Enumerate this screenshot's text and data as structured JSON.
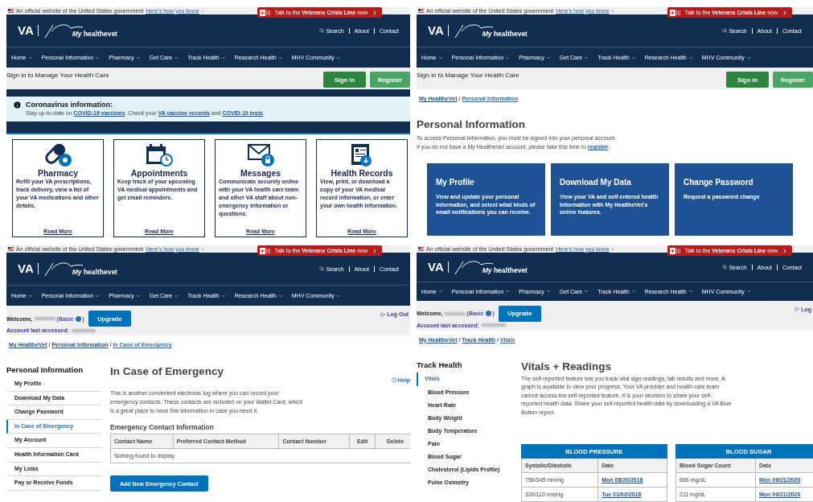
{
  "panels": [
    {
      "kind": "home",
      "header": {
        "banner_text": "An official website of the United States government",
        "banner_link": "Here's how you know",
        "crisis": "Talk to the **Veterans Crisis Line** now",
        "logo_mark": "VA",
        "logo_name": "*My* healthevet",
        "utility_links": [
          "Search",
          "About",
          "Contact"
        ],
        "nav": [
          "Home",
          "Personal Information",
          "Pharmacy",
          "Get Care",
          "Track Health",
          "Research Health",
          "MHV Community"
        ]
      },
      "signin": {
        "prompt": "Sign in to Manage Your Health Care",
        "buttons": [
          "Sign in",
          "Register"
        ]
      },
      "alert": {
        "title": "Coronavirus information:",
        "parts": [
          {
            "text": "Stay up-to-date on ",
            "link": false
          },
          {
            "text": "COVID-19 vaccines",
            "link": true
          },
          {
            "text": ". Check your ",
            "link": false
          },
          {
            "text": "VA vaccine records",
            "link": true
          },
          {
            "text": " and ",
            "link": false
          },
          {
            "text": "COVID-19 tests",
            "link": true
          },
          {
            "text": ".",
            "link": false
          }
        ]
      },
      "cards": [
        {
          "title": "Pharmacy",
          "text": "Refill your VA prescriptions, track delivery, view a list of your VA medications and other details.",
          "link": "Read More"
        },
        {
          "title": "Appointments",
          "text": "Keep track of your upcoming VA medical appointments and get email reminders.",
          "link": "Read More"
        },
        {
          "title": "Messages",
          "text": "Communicate securely online with your VA health care team and other VA staff about non-emergency information or questions.",
          "link": "Read More"
        },
        {
          "title": "Health Records",
          "text": "View, print, or download a copy of your VA medical record information, or enter your own health information.",
          "link": "Read More"
        }
      ]
    },
    {
      "kind": "landing",
      "header": {
        "banner_text": "An official website of the United States government",
        "banner_link": "Here's how you know",
        "crisis": "Talk to the **Veterans Crisis Line** now",
        "logo_mark": "VA",
        "logo_name": "*My* healthevet",
        "utility_links": [
          "Search",
          "About",
          "Contact"
        ],
        "nav": [
          "Home",
          "Personal Information",
          "Pharmacy",
          "Get Care",
          "Track Health",
          "Research Health",
          "MHV Community"
        ]
      },
      "signin": {
        "prompt": "Sign in to Manage Your Health Care",
        "buttons": [
          "Sign in",
          "Register"
        ]
      },
      "breadcrumb": [
        "My HealtheVet",
        "Personal Information"
      ],
      "breadcrumb_separator": "/",
      "title": "Personal Information",
      "parts": [
        {
          "text": "To access Personal Information, you must be signed into your personal account. If you do not have a My HealtheVet account, please take this time to ",
          "link": false
        },
        {
          "text": "register",
          "link": true
        },
        {
          "text": ".",
          "link": false
        }
      ],
      "tiles": [
        {
          "title": "My Profile",
          "text": "View and update your personal information, and select what kinds of email notifications you can receive."
        },
        {
          "title": "Download My Data",
          "text": "View your VA and self-entered health information with My HealtheVet's online features."
        },
        {
          "title": "Change Password",
          "text": "Request a password change"
        }
      ]
    },
    {
      "kind": "emergency",
      "header": {
        "banner_text": "An official website of the United States government",
        "banner_link": "Here's how you know",
        "crisis": "Talk to the **Veterans Crisis Line** now",
        "logo_mark": "VA",
        "logo_name": "*My* healthevet",
        "utility_links": [
          "Search",
          "About",
          "Contact"
        ],
        "nav": [
          "Home",
          "Personal Information",
          "Pharmacy",
          "Get Care",
          "Track Health",
          "Research Health",
          "MHV Community"
        ]
      },
      "account": {
        "welcome": "Welcome,",
        "level": "(Basic",
        "level_end": ")",
        "upgrade": "Upgrade",
        "last_accessed": "Account last accessed:",
        "logout": "Log Out"
      },
      "breadcrumb": [
        "My HealtheVet",
        "Personal Information",
        "In Case of Emergency"
      ],
      "breadcrumb_separator": "/",
      "sidebar": {
        "title": "Personal Information",
        "items": [
          {
            "label": "My Profile",
            "selected": false
          },
          {
            "label": "Download My Data",
            "selected": false
          },
          {
            "label": "Change Password",
            "selected": false
          },
          {
            "label": "In Case of Emergency",
            "selected": true
          },
          {
            "label": "My Account",
            "selected": false
          },
          {
            "label": "Health Information Card",
            "selected": false
          },
          {
            "label": "My Links",
            "selected": false
          },
          {
            "label": "Pay or Receive Funds",
            "selected": false
          }
        ]
      },
      "title": "In Case of Emergency",
      "help": "Help",
      "text": "This is another convenient electronic log where you can record your emergency contacts. These contacts are included on your Wallet Card, which is a great place to have this information in case you need it.",
      "subtitle": "Emergency Contact Information",
      "table": {
        "columns": [
          "Contact Name",
          "Preferred Contact Method",
          "Contact Number",
          "Edit",
          "Delete"
        ],
        "empty": "Nothing found to display."
      },
      "add_button": "Add New Emergency Contact"
    },
    {
      "kind": "vitals",
      "header": {
        "banner_text": "An official website of the United States government",
        "banner_link": "Here's how you know",
        "crisis": "Talk to the **Veterans Crisis Line** now",
        "logo_mark": "VA",
        "logo_name": "*My* healthevet",
        "utility_links": [
          "Search",
          "About",
          "Contact"
        ],
        "nav": [
          "Home",
          "Personal Information",
          "Pharmacy",
          "Get Care",
          "Track Health",
          "Research Health",
          "MHV Community"
        ]
      },
      "account": {
        "welcome": "Welcome,",
        "level": "(Basic",
        "level_end": ")",
        "upgrade": "Upgrade",
        "last_accessed": "Account last accessed:",
        "logout": "Log"
      },
      "breadcrumb": [
        "My HealtheVet",
        "Track Health",
        "Vitals"
      ],
      "breadcrumb_separator": "/",
      "sidebar": {
        "title": "Track Health",
        "items": [
          {
            "label": "Vitals",
            "selected": true,
            "children": [
              {
                "label": "Blood Pressure",
                "selected": false
              },
              {
                "label": "Heart Rate",
                "selected": false
              },
              {
                "label": "Body Weight",
                "selected": false
              },
              {
                "label": "Body Temperature",
                "selected": false
              },
              {
                "label": "Pain",
                "selected": false
              },
              {
                "label": "Blood Sugar",
                "selected": false
              },
              {
                "label": "Cholesterol (Lipids Profile)",
                "selected": false
              },
              {
                "label": "Pulse Oximetry",
                "selected": false
              }
            ]
          }
        ]
      },
      "title": "Vitals + Readings",
      "text": "The self-reported feature lets you track vital sign readings, lab results and more. A graph is available to view your progress. Your VA provider and health care team cannot access the self-reported feature. It is your decision to share your self-reported health data. Share your self-reported health data by downloading a VA Blue Button report.",
      "tables": [
        {
          "title": "BLOOD PRESSURE",
          "columns": [
            "Systolic/Diastolic",
            "Date"
          ],
          "rows": [
            [
              "756/345 mmHg",
              "Mon 08/20/2018"
            ],
            [
              "320/110 mmHg",
              "Tue 01/02/2018"
            ]
          ]
        },
        {
          "title": "BLOOD SUGAR",
          "columns": [
            "Blood Sugar Count",
            "Date"
          ],
          "rows": [
            [
              "666 mg/dL",
              "Mon 09/21/2020"
            ],
            [
              "211 mg/dL",
              "Mon 09/21/2020"
            ]
          ]
        }
      ]
    }
  ]
}
